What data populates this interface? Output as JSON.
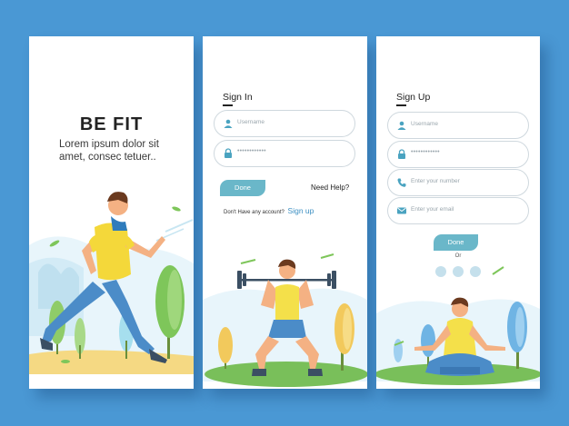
{
  "screens": {
    "intro": {
      "brand": "BE FIT",
      "tagline": "Lorem ipsum dolor sit amet, consec tetuer.."
    },
    "signin": {
      "title": "Sign In",
      "username_placeholder": "Username",
      "password_mask": "••••••••••••",
      "done_label": "Done",
      "help_link": "Need Help?",
      "no_account_text": "Don't Have any account?",
      "signup_link": "Sign up"
    },
    "signup": {
      "title": "Sign Up",
      "username_placeholder": "Username",
      "password_mask": "••••••••••••",
      "number_placeholder": "Enter your number",
      "email_placeholder": "Enter your email",
      "done_label": "Done",
      "or_text": "Or"
    }
  },
  "icons": {
    "user": "user-icon",
    "lock": "lock-icon",
    "phone": "phone-icon",
    "mail": "mail-icon"
  },
  "colors": {
    "background": "#4a98d4",
    "accent": "#6ab7c9",
    "link": "#3c8fc2",
    "field_border": "#cfd8de",
    "icon": "#4aa3c0"
  }
}
